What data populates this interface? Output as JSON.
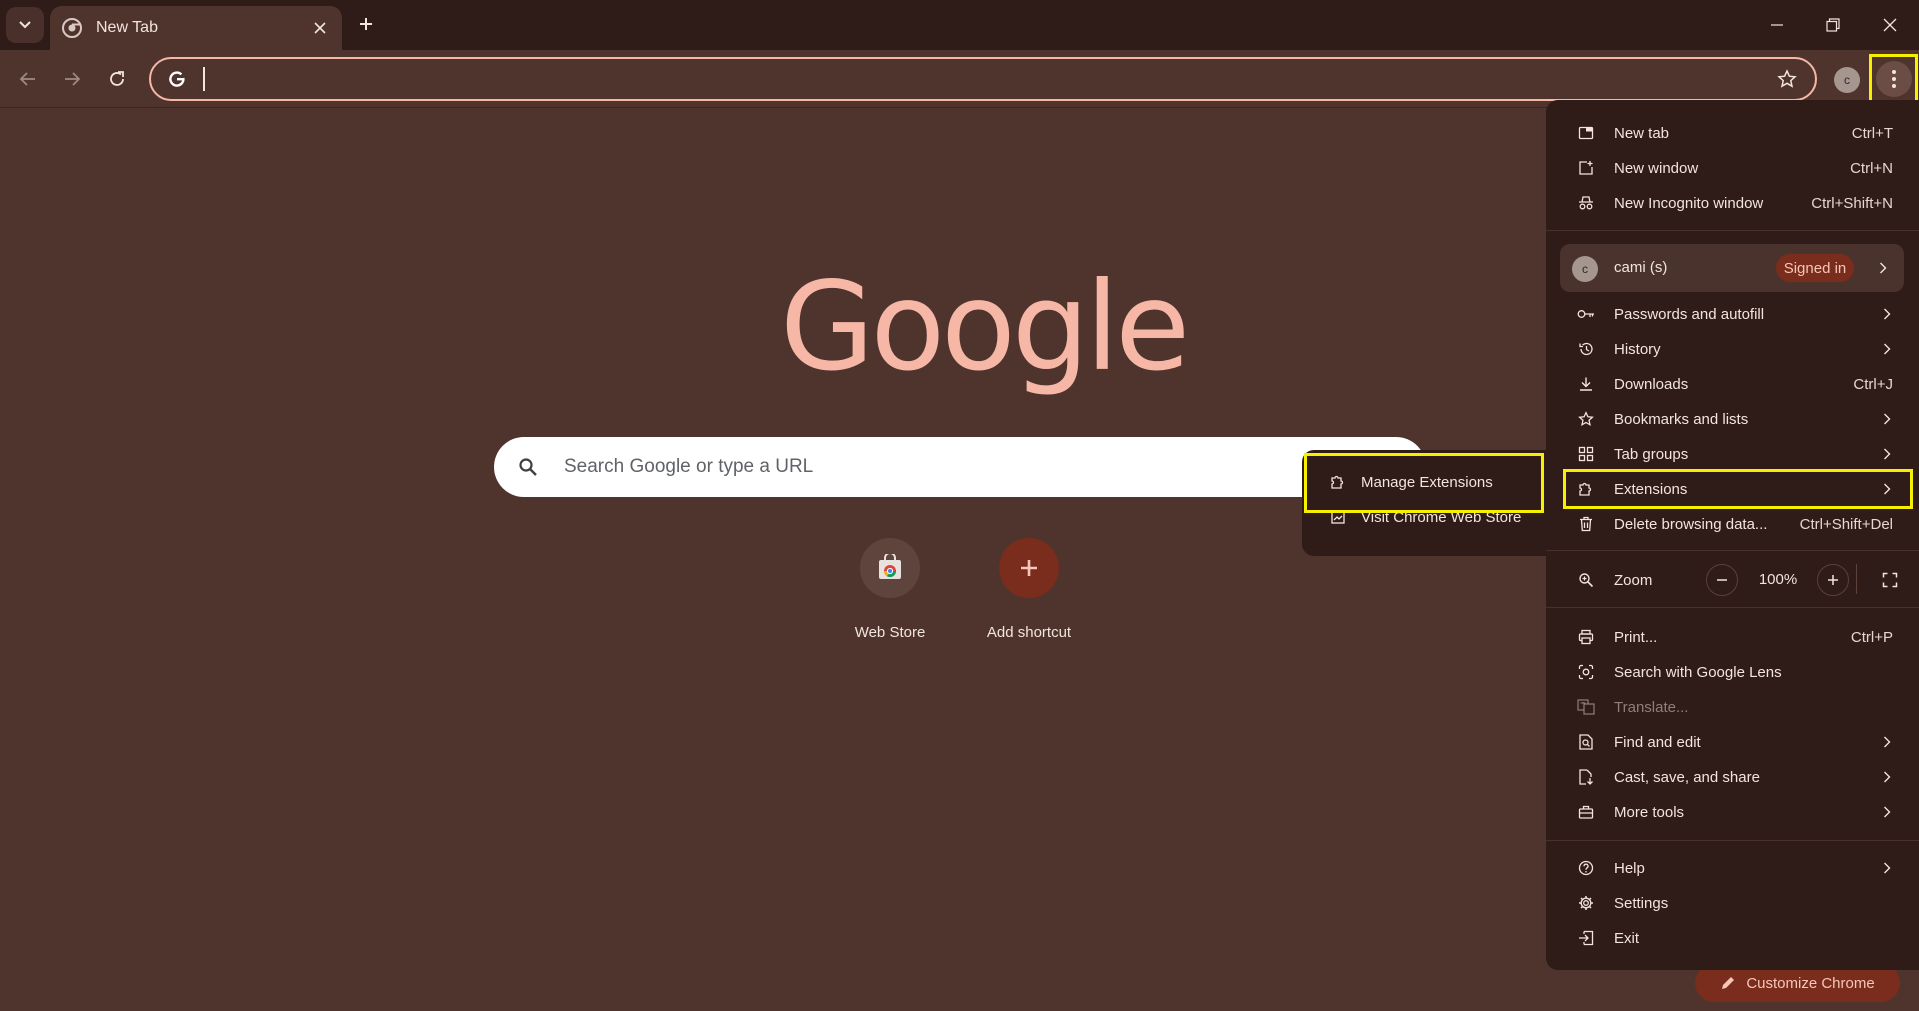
{
  "browser": {
    "tab_title": "New Tab",
    "omnibox_value": "",
    "profile_initial": "c"
  },
  "ntp": {
    "logo_text": "Google",
    "search_placeholder": "Search Google or type a URL",
    "shortcuts": [
      {
        "label": "Web Store"
      },
      {
        "label": "Add shortcut"
      }
    ],
    "customize_label": "Customize Chrome"
  },
  "menu": {
    "new_tab": {
      "label": "New tab",
      "shortcut": "Ctrl+T"
    },
    "new_window": {
      "label": "New window",
      "shortcut": "Ctrl+N"
    },
    "new_incognito": {
      "label": "New Incognito window",
      "shortcut": "Ctrl+Shift+N"
    },
    "profile": {
      "initial": "c",
      "name": "cami (s)",
      "status": "Signed in"
    },
    "passwords": {
      "label": "Passwords and autofill"
    },
    "history": {
      "label": "History"
    },
    "downloads": {
      "label": "Downloads",
      "shortcut": "Ctrl+J"
    },
    "bookmarks": {
      "label": "Bookmarks and lists"
    },
    "tab_groups": {
      "label": "Tab groups"
    },
    "extensions": {
      "label": "Extensions"
    },
    "delete_data": {
      "label": "Delete browsing data...",
      "shortcut": "Ctrl+Shift+Del"
    },
    "zoom": {
      "label": "Zoom",
      "value": "100%"
    },
    "print": {
      "label": "Print...",
      "shortcut": "Ctrl+P"
    },
    "lens": {
      "label": "Search with Google Lens"
    },
    "translate": {
      "label": "Translate..."
    },
    "find_edit": {
      "label": "Find and edit"
    },
    "cast_save": {
      "label": "Cast, save, and share"
    },
    "more_tools": {
      "label": "More tools"
    },
    "help": {
      "label": "Help"
    },
    "settings": {
      "label": "Settings"
    },
    "exit": {
      "label": "Exit"
    }
  },
  "submenu": {
    "manage_extensions": "Manage Extensions",
    "visit_store": "Visit Chrome Web Store"
  },
  "colors": {
    "background": "#4f342d",
    "menu_bg": "#2f1b17",
    "accent": "#f6b7a6",
    "highlight": "#f6f000"
  }
}
